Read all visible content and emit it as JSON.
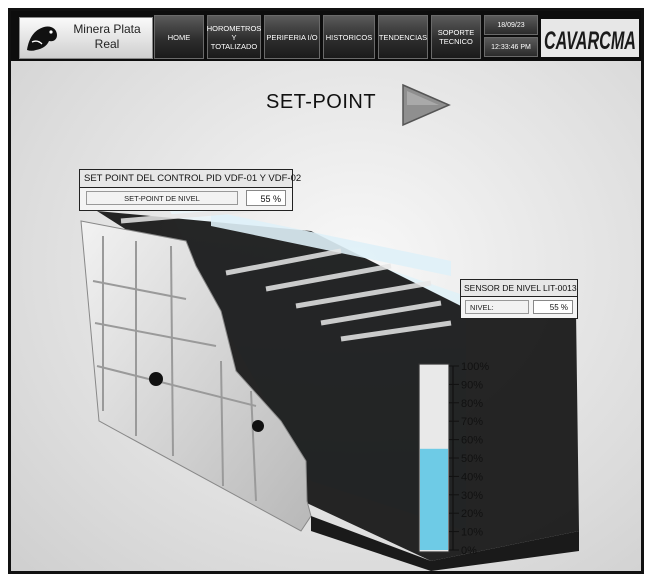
{
  "header": {
    "brand_line1": "Minera Plata",
    "brand_line2": "Real",
    "nav": [
      {
        "label": "HOME"
      },
      {
        "label": "HOROMETROS\nY\nTOTALIZADO"
      },
      {
        "label": "PERIFERIA I/O"
      },
      {
        "label": "HISTORICOS"
      },
      {
        "label": "TENDENCIAS"
      },
      {
        "label": "SOPORTE\nTECNICO"
      }
    ],
    "date": "18/09/23",
    "time": "12:33:46 PM",
    "logo_text": "CAVARCMA"
  },
  "page": {
    "title": "SET-POINT",
    "next_icon": "play-arrow-icon"
  },
  "pid_panel": {
    "title": "SET POINT DEL CONTROL PID VDF-01 Y VDF-02",
    "label": "SET-POINT DE NIVEL",
    "value": "55 %"
  },
  "sensor_panel": {
    "title": "SENSOR DE NIVEL LIT-0013",
    "label": "NIVEL:",
    "value": "55 %"
  },
  "level_gauge": {
    "level_percent": 55,
    "fill_color": "#6ecbe6",
    "ticks": [
      "100%",
      "90%",
      "80%",
      "70%",
      "60%",
      "50%",
      "40%",
      "30%",
      "20%",
      "10%",
      "0%"
    ]
  }
}
